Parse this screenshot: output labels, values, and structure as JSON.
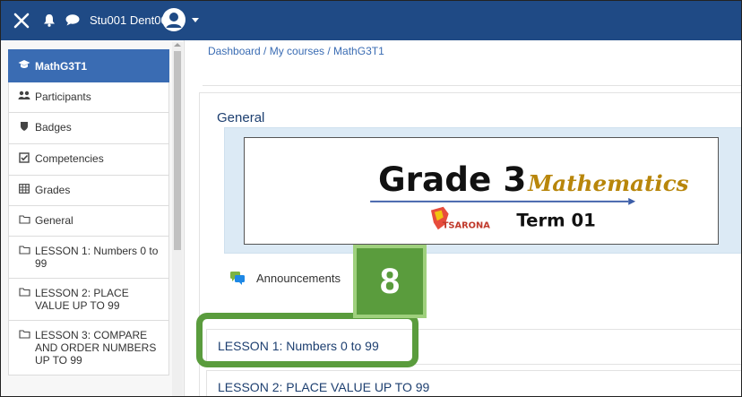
{
  "navbar": {
    "username": "Stu001 Dent001",
    "icons": [
      "close-icon",
      "bell-icon",
      "chat-icon",
      "avatar-icon",
      "caret-down-icon"
    ],
    "background": "#1f4a85"
  },
  "sidebar": {
    "items": [
      {
        "label": "MathG3T1",
        "icon": "graduation-cap-icon",
        "active": true
      },
      {
        "label": "Participants",
        "icon": "users-icon"
      },
      {
        "label": "Badges",
        "icon": "shield-icon"
      },
      {
        "label": "Competencies",
        "icon": "checkbox-icon"
      },
      {
        "label": "Grades",
        "icon": "table-icon"
      },
      {
        "label": "General",
        "icon": "folder-icon"
      },
      {
        "label": "LESSON 1: Numbers 0 to 99",
        "icon": "folder-icon"
      },
      {
        "label": "LESSON 2: PLACE VALUE UP TO 99",
        "icon": "folder-icon"
      },
      {
        "label": "LESSON 3: COMPARE AND ORDER NUMBERS UP TO 99",
        "icon": "folder-icon"
      }
    ],
    "active_color": "#3a6cb3"
  },
  "breadcrumb": "Dashboard / My courses / MathG3T1",
  "section": {
    "title": "General",
    "banner": {
      "title": "Grade 3",
      "subject": "Mathematics",
      "term": "Term 01",
      "logo_text": "TSARONA"
    },
    "announcements_label": "Announcements"
  },
  "lessons": [
    "LESSON 1: Numbers 0 to 99",
    "LESSON 2: PLACE VALUE UP TO 99"
  ],
  "overlay": {
    "step_number": "8",
    "color": "#5a9c3d"
  }
}
